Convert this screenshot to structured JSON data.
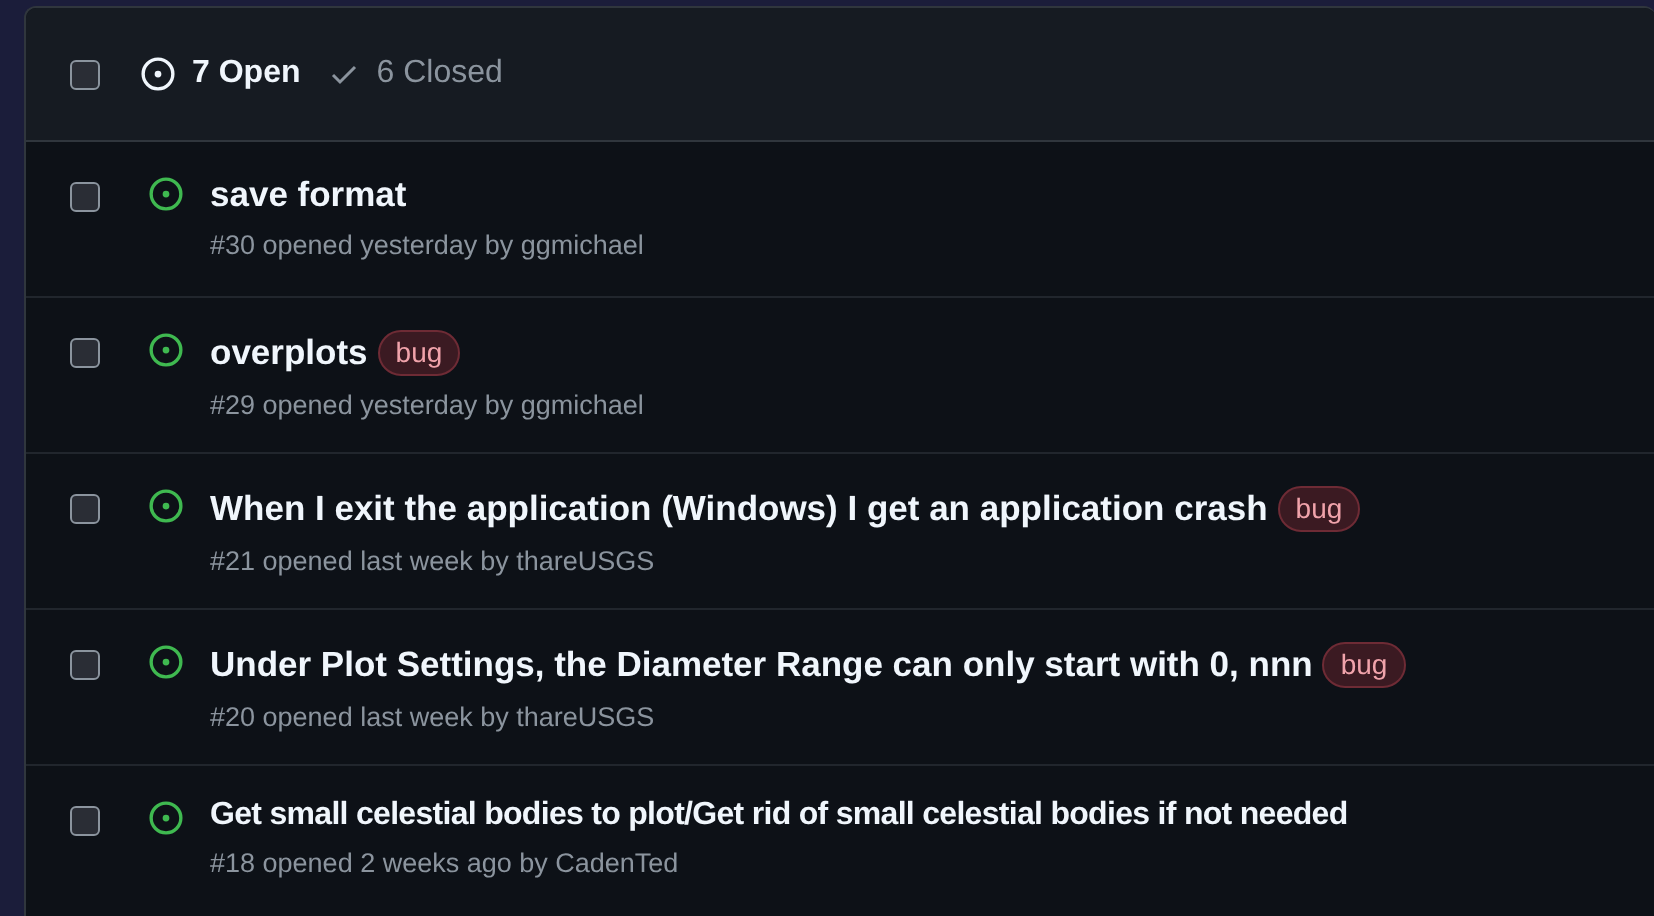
{
  "header": {
    "select_all_checked": false,
    "filters": [
      {
        "kind": "open",
        "label": "7 Open",
        "selected": true
      },
      {
        "kind": "closed",
        "label": "6 Closed",
        "selected": false
      }
    ]
  },
  "issues": [
    {
      "title": "save format",
      "meta": "#30 opened yesterday by ggmichael",
      "checked": false
    },
    {
      "title": "overplots",
      "labels": [
        {
          "name": "bug",
          "color": "#6e2b35"
        }
      ],
      "meta": "#29 opened yesterday by ggmichael",
      "checked": false
    },
    {
      "title": "When I exit the application (Windows) I get an application crash",
      "labels": [
        {
          "name": "bug",
          "color": "#6e2b35"
        }
      ],
      "meta": "#21 opened last week by thareUSGS",
      "checked": false
    },
    {
      "title": "Under Plot Settings, the Diameter Range can only start with 0, nnn",
      "labels": [
        {
          "name": "bug",
          "color": "#6e2b35"
        }
      ],
      "meta": "#20 opened last week by thareUSGS",
      "checked": false
    },
    {
      "title": "Get small celestial bodies to plot/Get rid of small celestial bodies if not needed",
      "meta": "#18 opened 2 weeks ago by CadenTed",
      "checked": false
    }
  ]
}
